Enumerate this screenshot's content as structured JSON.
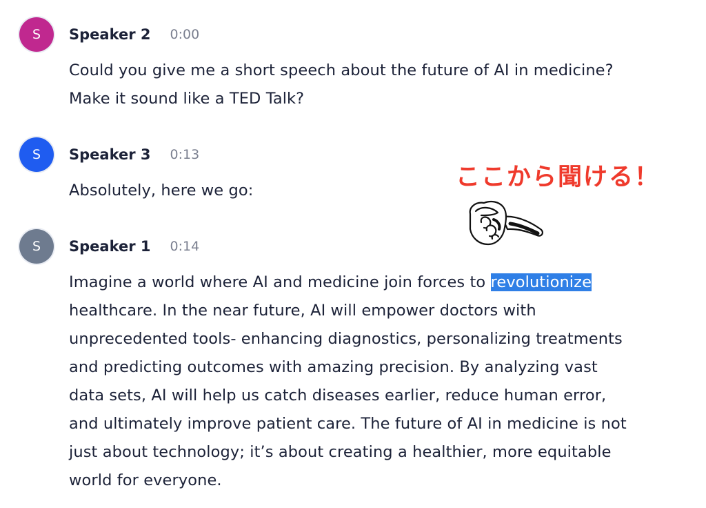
{
  "entries": [
    {
      "initial": "S",
      "speaker": "Speaker 2",
      "time": "0:00",
      "avatar_color": "#c0288f",
      "text": "Could you give me a short speech about the future of AI in medicine?\nMake it sound like a TED Talk?"
    },
    {
      "initial": "S",
      "speaker": "Speaker 3",
      "time": "0:13",
      "avatar_color": "#1f5cf0",
      "text": "Absolutely, here we go:"
    },
    {
      "initial": "S",
      "speaker": "Speaker 1",
      "time": "0:14",
      "avatar_color": "#6e7b8f",
      "text_before": "Imagine a world where AI and medicine join forces to ",
      "text_highlight": "revolutionize",
      "text_after": "\nhealthcare. In the near future, AI will empower doctors with\nunprecedented tools- enhancing diagnostics, personalizing treatments\nand predicting outcomes with amazing precision. By analyzing vast\ndata sets, AI will help us catch diseases earlier, reduce human error,\nand ultimately improve patient care. The future of AI in medicine is not\njust about technology; it’s about creating a healthier, more equitable\nworld for everyone."
    }
  ],
  "annotation": {
    "text": "ここから聞ける！",
    "color": "#ef3a2c",
    "icon": "pointing-hand-icon"
  },
  "highlight_color": "#2f7fe6"
}
